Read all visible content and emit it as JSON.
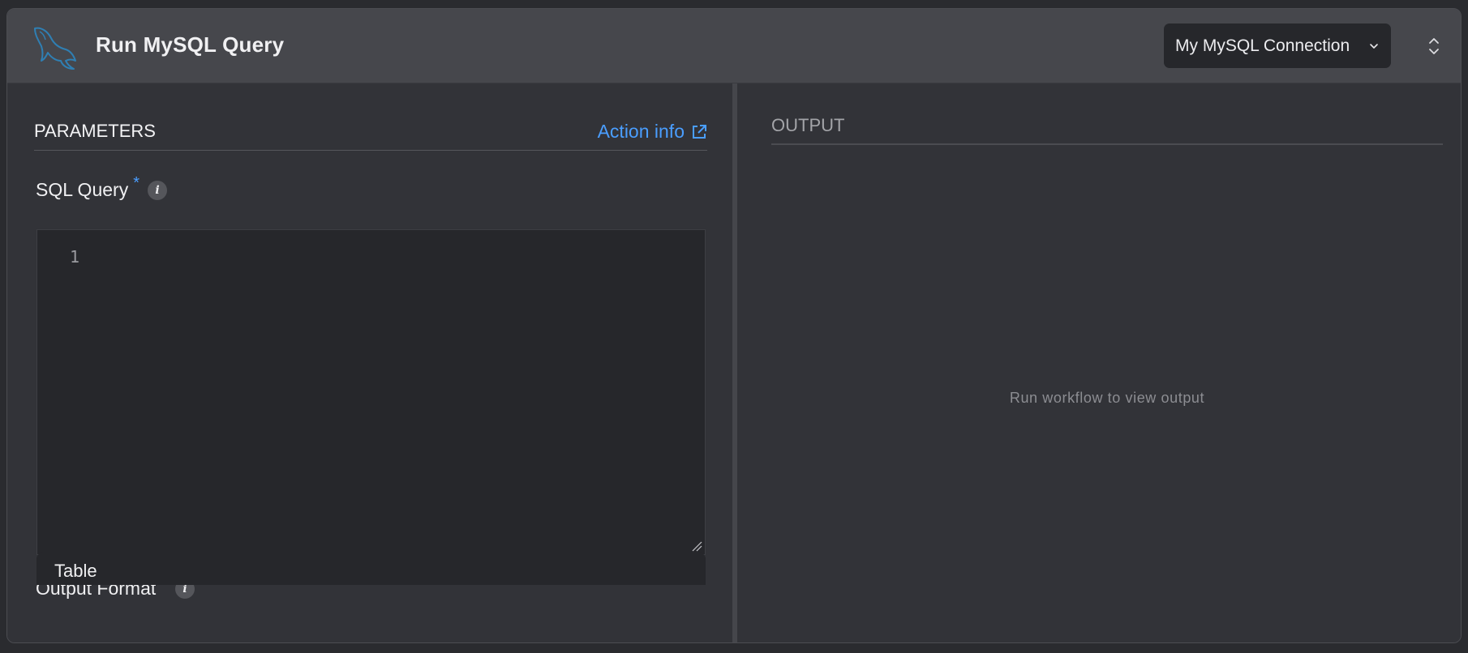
{
  "header": {
    "title": "Run MySQL Query",
    "logo_icon": "mysql-dolphin-icon",
    "connection": {
      "selected": "My MySQL Connection"
    },
    "expand_icon": "unfold-icon"
  },
  "parameters": {
    "section_title": "PARAMETERS",
    "action_info_label": "Action info",
    "action_info_icon": "external-link-icon",
    "fields": {
      "sql_query": {
        "label": "SQL Query",
        "required_mark": "*",
        "info_glyph": "i",
        "line_number": "1",
        "value": ""
      },
      "output_format": {
        "label": "Output Format",
        "required_mark": "*",
        "info_glyph": "i",
        "value": "Table"
      }
    }
  },
  "output": {
    "section_title": "OUTPUT",
    "empty_message": "Run workflow to view output"
  },
  "colors": {
    "accent": "#4a9eff",
    "header_bg": "#46474c",
    "panel_bg": "#323338",
    "input_bg": "#26272b"
  }
}
